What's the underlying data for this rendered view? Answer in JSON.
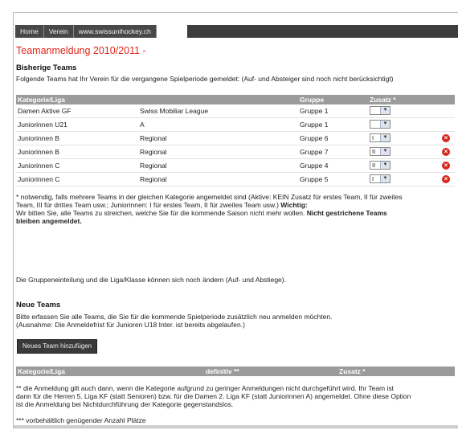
{
  "nav": [
    "Home",
    "Verein",
    "www.swissunihockey.ch"
  ],
  "title": "Teamanmeldung 2010/2011 -",
  "previous": {
    "heading": "Bisherige Teams",
    "intro": "Folgende Teams hat Ihr Verein für die vergangene Spielperiode gemeldet: (Auf- und Absteiger sind noch nicht berücksichtigt)",
    "headers": {
      "kategorie": "Kategorie/Liga",
      "gruppe": "Gruppe",
      "zusatz": "Zusatz *"
    },
    "rows": [
      {
        "kategorie": "Damen Aktive GF",
        "liga": "Swiss Mobiliar League",
        "gruppe": "Gruppe 1",
        "zusatz": ""
      },
      {
        "kategorie": "Juniorinnen U21",
        "liga": "A",
        "gruppe": "Gruppe 1",
        "zusatz": ""
      },
      {
        "kategorie": "Juniorinnen B",
        "liga": "Regional",
        "gruppe": "Gruppe 6",
        "zusatz": "I"
      },
      {
        "kategorie": "Juniorinnen B",
        "liga": "Regional",
        "gruppe": "Gruppe 7",
        "zusatz": "II"
      },
      {
        "kategorie": "Juniorinnen C",
        "liga": "Regional",
        "gruppe": "Gruppe 4",
        "zusatz": "II"
      },
      {
        "kategorie": "Juniorinnen C",
        "liga": "Regional",
        "gruppe": "Gruppe 5",
        "zusatz": "I"
      }
    ],
    "footnote_1": "* notwendig, falls mehrere Teams in der gleichen Kategorie angemeldet sind (Aktive: KEIN Zusatz für erstes Team, II für zweites",
    "footnote_2": "Team, III für drittes Team usw.; Juniorinnen: I für erstes Team, II für zweites Team usw.)",
    "wichtig": "Wichtig:",
    "note_1": "Wir bitten Sie, alle Teams zu streichen, welche Sie für die kommende Saison nicht mehr wollen.",
    "note_bold_1": "Nicht gestrichene Teams",
    "note_bold_2": "bleiben angemeldet."
  },
  "gruppen_note": "Die Gruppeneinteilung und die Liga/Klasse können sich noch ändern (Auf- und Abstiege).",
  "new": {
    "heading": "Neue Teams",
    "intro_1": "Bitte erfassen Sie alle Teams, die Sie für die kommende Spielperiode zusätzlich neu anmelden möchten.",
    "intro_2": "(Ausnahme: Die Anmeldefrist für Junioren U18 Inter. ist bereits abgelaufen.)",
    "button": "Neues Team hinzufügen",
    "headers": {
      "kategorie": "Kategorie/Liga",
      "definitiv": "definitiv **",
      "zusatz": "Zusatz *"
    }
  },
  "footer": {
    "note_1": "** die Anmeldung gilt auch dann, wenn die Kategorie aufgrund zu geringer Anmeldungen nicht durchgeführt wird. Ihr Team ist",
    "note_2": "dann für die Herren 5. Liga KF (statt Senioren) bzw. für die Damen 2. Liga KF (statt Juniorinnen A) angemeldet. Ohne diese Option",
    "note_3": "ist die Anmeldung bei Nichtdurchführung der Kategorie gegenstandslos.",
    "note_4": "*** vorbehältlich genügender Anzahl Plätze"
  }
}
